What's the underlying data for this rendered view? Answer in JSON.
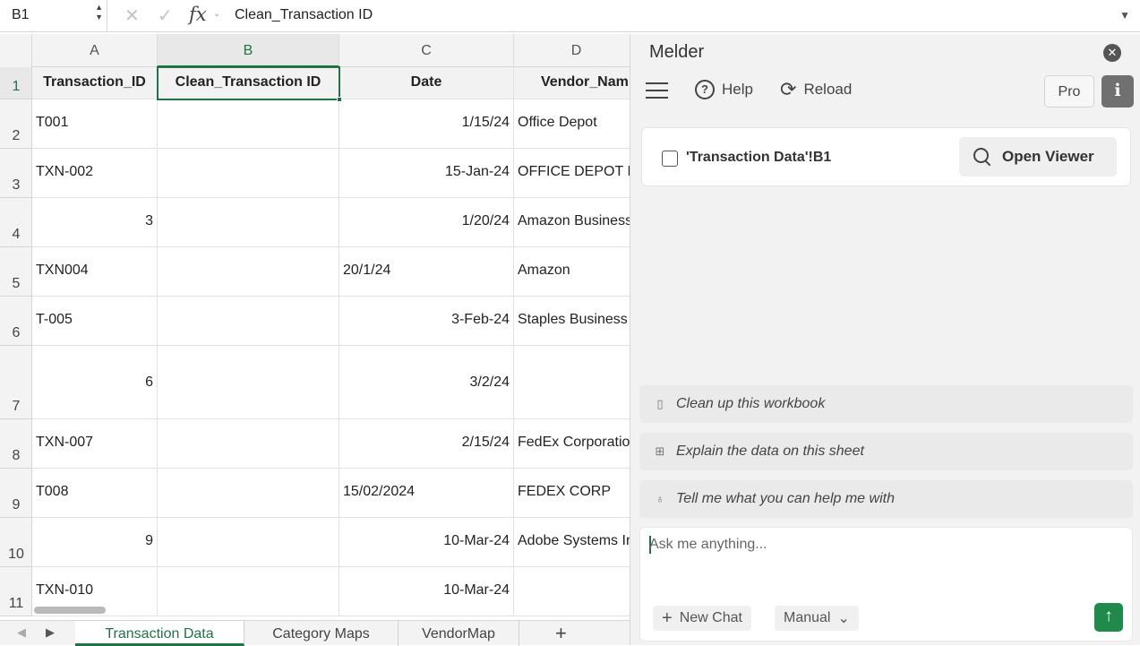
{
  "formula_bar": {
    "name_box": "B1",
    "cancel_icon": "✕",
    "confirm_icon": "✓",
    "fx_label": "fx",
    "value": "Clean_Transaction ID"
  },
  "grid": {
    "columns": [
      "A",
      "B",
      "C",
      "D"
    ],
    "rows": [
      "1",
      "2",
      "3",
      "4",
      "5",
      "6",
      "7",
      "8",
      "9",
      "10",
      "11"
    ],
    "headers": {
      "a": "Transaction_ID",
      "b": "Clean_Transaction ID",
      "c": "Date",
      "d": "Vendor_Nam"
    },
    "cells": [
      {
        "a": "T001",
        "b": "",
        "c": "1/15/24",
        "d": "Office Depot"
      },
      {
        "a": "TXN-002",
        "b": "",
        "c": "15-Jan-24",
        "d": "OFFICE DEPOT IN"
      },
      {
        "a": "3",
        "b": "",
        "c": "1/20/24",
        "d": "Amazon Business"
      },
      {
        "a": "TXN004",
        "b": "",
        "c": "20/1/24",
        "d": "Amazon"
      },
      {
        "a": "T-005",
        "b": "",
        "c": "3-Feb-24",
        "d": "Staples Business"
      },
      {
        "a": "6",
        "b": "",
        "c": "3/2/24",
        "d": ""
      },
      {
        "a": "TXN-007",
        "b": "",
        "c": "2/15/24",
        "d": "FedEx Corporation"
      },
      {
        "a": "T008",
        "b": "",
        "c": "15/02/2024",
        "d": "FEDEX CORP"
      },
      {
        "a": "9",
        "b": "",
        "c": "10-Mar-24",
        "d": "Adobe Systems Inc"
      },
      {
        "a": "TXN-010",
        "b": "",
        "c": "10-Mar-24",
        "d": ""
      }
    ]
  },
  "sheet_tabs": [
    "Transaction Data",
    "Category Maps",
    "VendorMap"
  ],
  "add_sheet": "+",
  "panel": {
    "title": "Melder",
    "help_label": "Help",
    "reload_label": "Reload",
    "pro_label": "Pro",
    "info_label": "i",
    "context_ref": "'Transaction Data'!B1",
    "open_viewer_label": "Open Viewer",
    "suggestions": [
      "Clean up this workbook",
      "Explain the data on this sheet",
      "Tell me what you can help me with"
    ],
    "chat_placeholder": "Ask me anything...",
    "new_chat_label": "New Chat",
    "mode_label": "Manual"
  },
  "colors": {
    "accent": "#217346",
    "send": "#1f8a4c"
  }
}
